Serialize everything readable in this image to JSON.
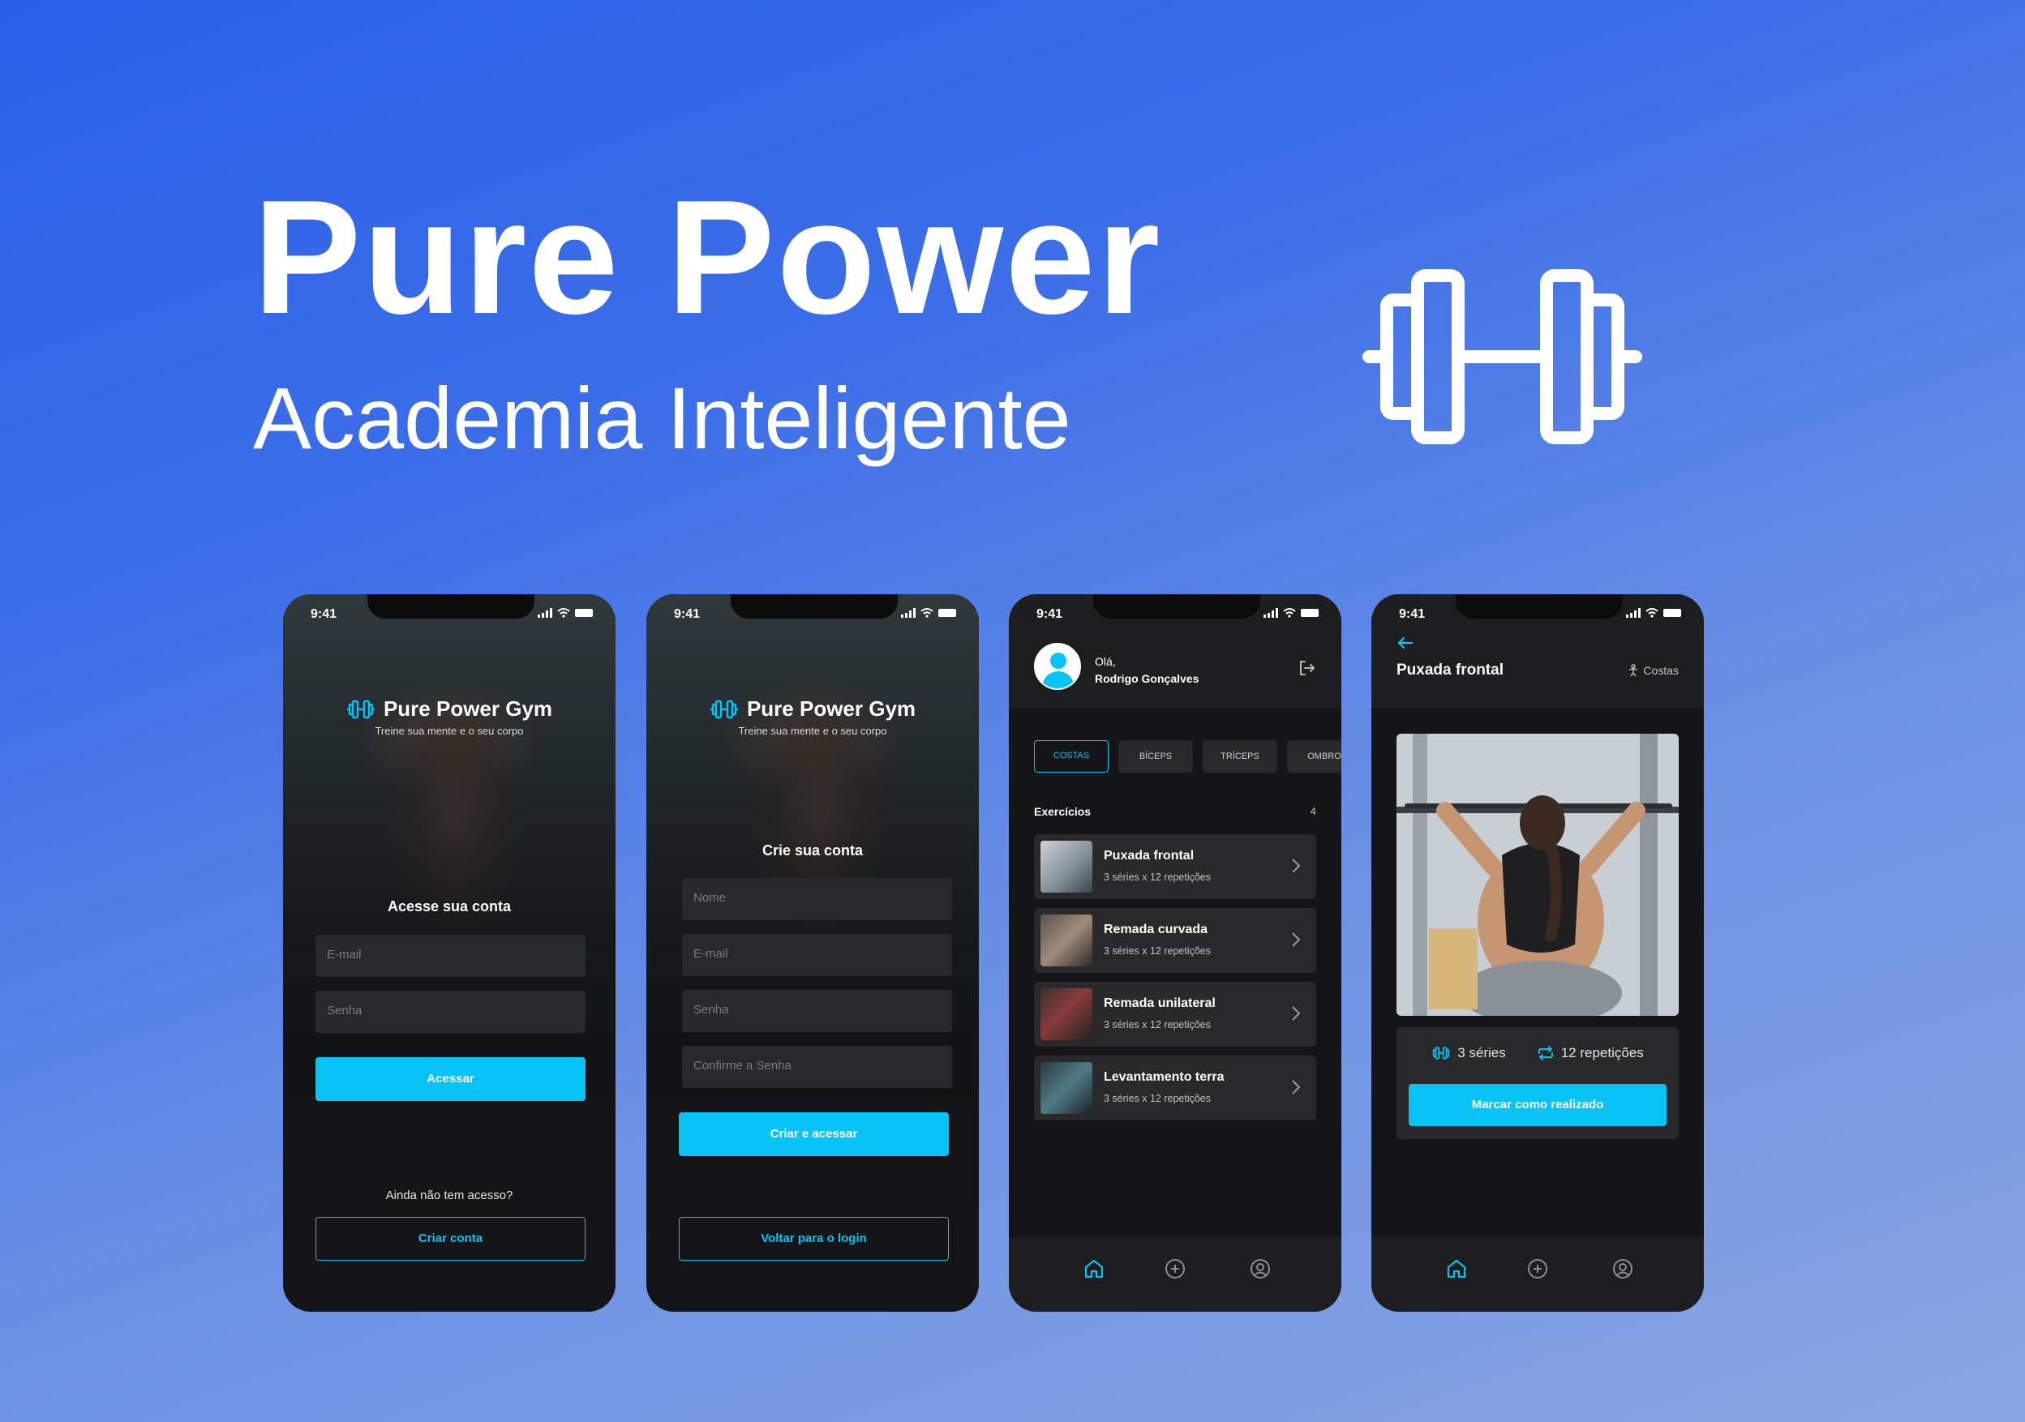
{
  "hero": {
    "title": "Pure Power",
    "subtitle": "Academia Inteligente"
  },
  "status_time": "9:41",
  "brand": {
    "name": "Pure Power Gym",
    "tagline": "Treine sua mente e o seu corpo",
    "logo_icon": "dumbbell-icon"
  },
  "login": {
    "heading": "Acesse sua conta",
    "email_placeholder": "E-mail",
    "password_placeholder": "Senha",
    "submit_label": "Acessar",
    "no_account_text": "Ainda não tem acesso?",
    "create_label": "Criar conta"
  },
  "signup": {
    "heading": "Crie sua conta",
    "name_placeholder": "Nome",
    "email_placeholder": "E-mail",
    "password_placeholder": "Senha",
    "confirm_placeholder": "Confirme  a Senha",
    "submit_label": "Criar e acessar",
    "back_label": "Voltar para o login"
  },
  "home": {
    "greeting": "Olá,",
    "user_name": "Rodrigo Gonçalves",
    "tabs": [
      "COSTAS",
      "BÍCEPS",
      "TRÍCEPS",
      "OMBRO"
    ],
    "list_title": "Exercícios",
    "list_count": "4",
    "exercises": [
      {
        "name": "Puxada frontal",
        "meta": "3 séries x 12 repetições"
      },
      {
        "name": "Remada curvada",
        "meta": "3 séries x 12 repetições"
      },
      {
        "name": "Remada unilateral",
        "meta": "3 séries x 12 repetições"
      },
      {
        "name": "Levantamento terra",
        "meta": "3 séries x 12 repetições"
      }
    ]
  },
  "detail": {
    "title": "Puxada frontal",
    "group": "Costas",
    "series": "3 séries",
    "reps": "12 repetições",
    "done_label": "Marcar como realizado"
  },
  "colors": {
    "accent": "#08c4f6",
    "phone_bg": "#151517",
    "card_bg": "#29292c",
    "bg_top": "#2a5fe8",
    "bg_bottom": "#8aa6e2"
  }
}
